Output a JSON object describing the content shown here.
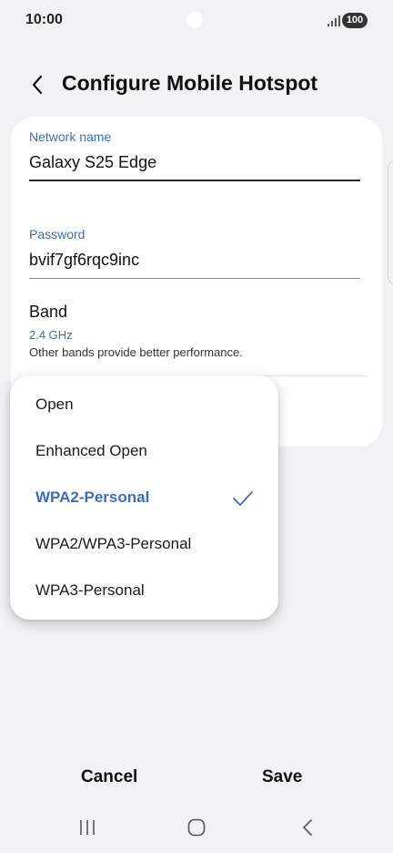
{
  "status_bar": {
    "time": "10:00",
    "battery": "100"
  },
  "header": {
    "title": "Configure Mobile Hotspot"
  },
  "form": {
    "network_name_label": "Network name",
    "network_name_value": "Galaxy S25 Edge",
    "password_label": "Password",
    "password_value": "bvif7gf6rqc9inc",
    "band_title": "Band",
    "band_value": "2.4 GHz",
    "band_description": "Other bands provide better performance."
  },
  "security_dropdown": {
    "options": [
      {
        "label": "Open",
        "selected": false
      },
      {
        "label": "Enhanced Open",
        "selected": false
      },
      {
        "label": "WPA2-Personal",
        "selected": true
      },
      {
        "label": "WPA2/WPA3-Personal",
        "selected": false
      },
      {
        "label": "WPA3-Personal",
        "selected": false
      }
    ],
    "selected_icon": "check-icon"
  },
  "actions": {
    "cancel_label": "Cancel",
    "save_label": "Save"
  },
  "nav_bar": {
    "icons": [
      "recents-icon",
      "home-icon",
      "back-icon"
    ]
  },
  "colors": {
    "accent": "#3d6cbd",
    "background": "#f2f2f5",
    "card": "#ffffff"
  }
}
